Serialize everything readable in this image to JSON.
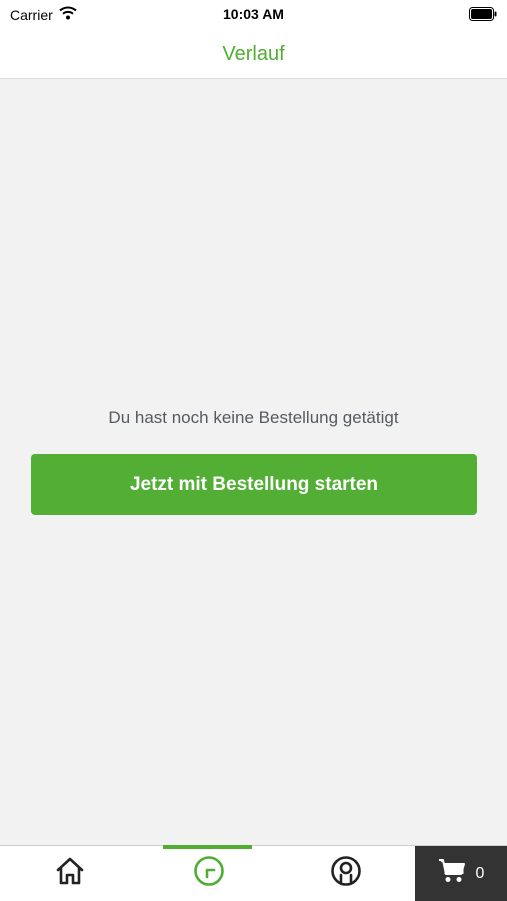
{
  "status_bar": {
    "carrier": "Carrier",
    "time": "10:03 AM"
  },
  "nav": {
    "title": "Verlauf"
  },
  "main": {
    "empty_message": "Du hast noch keine Bestellung getätigt",
    "cta_label": "Jetzt mit Bestellung starten"
  },
  "tab_bar": {
    "active_tab": "history",
    "cart_count": "0"
  },
  "colors": {
    "accent": "#4fae32",
    "cart_bg": "#333333",
    "background": "#f2f2f2"
  }
}
